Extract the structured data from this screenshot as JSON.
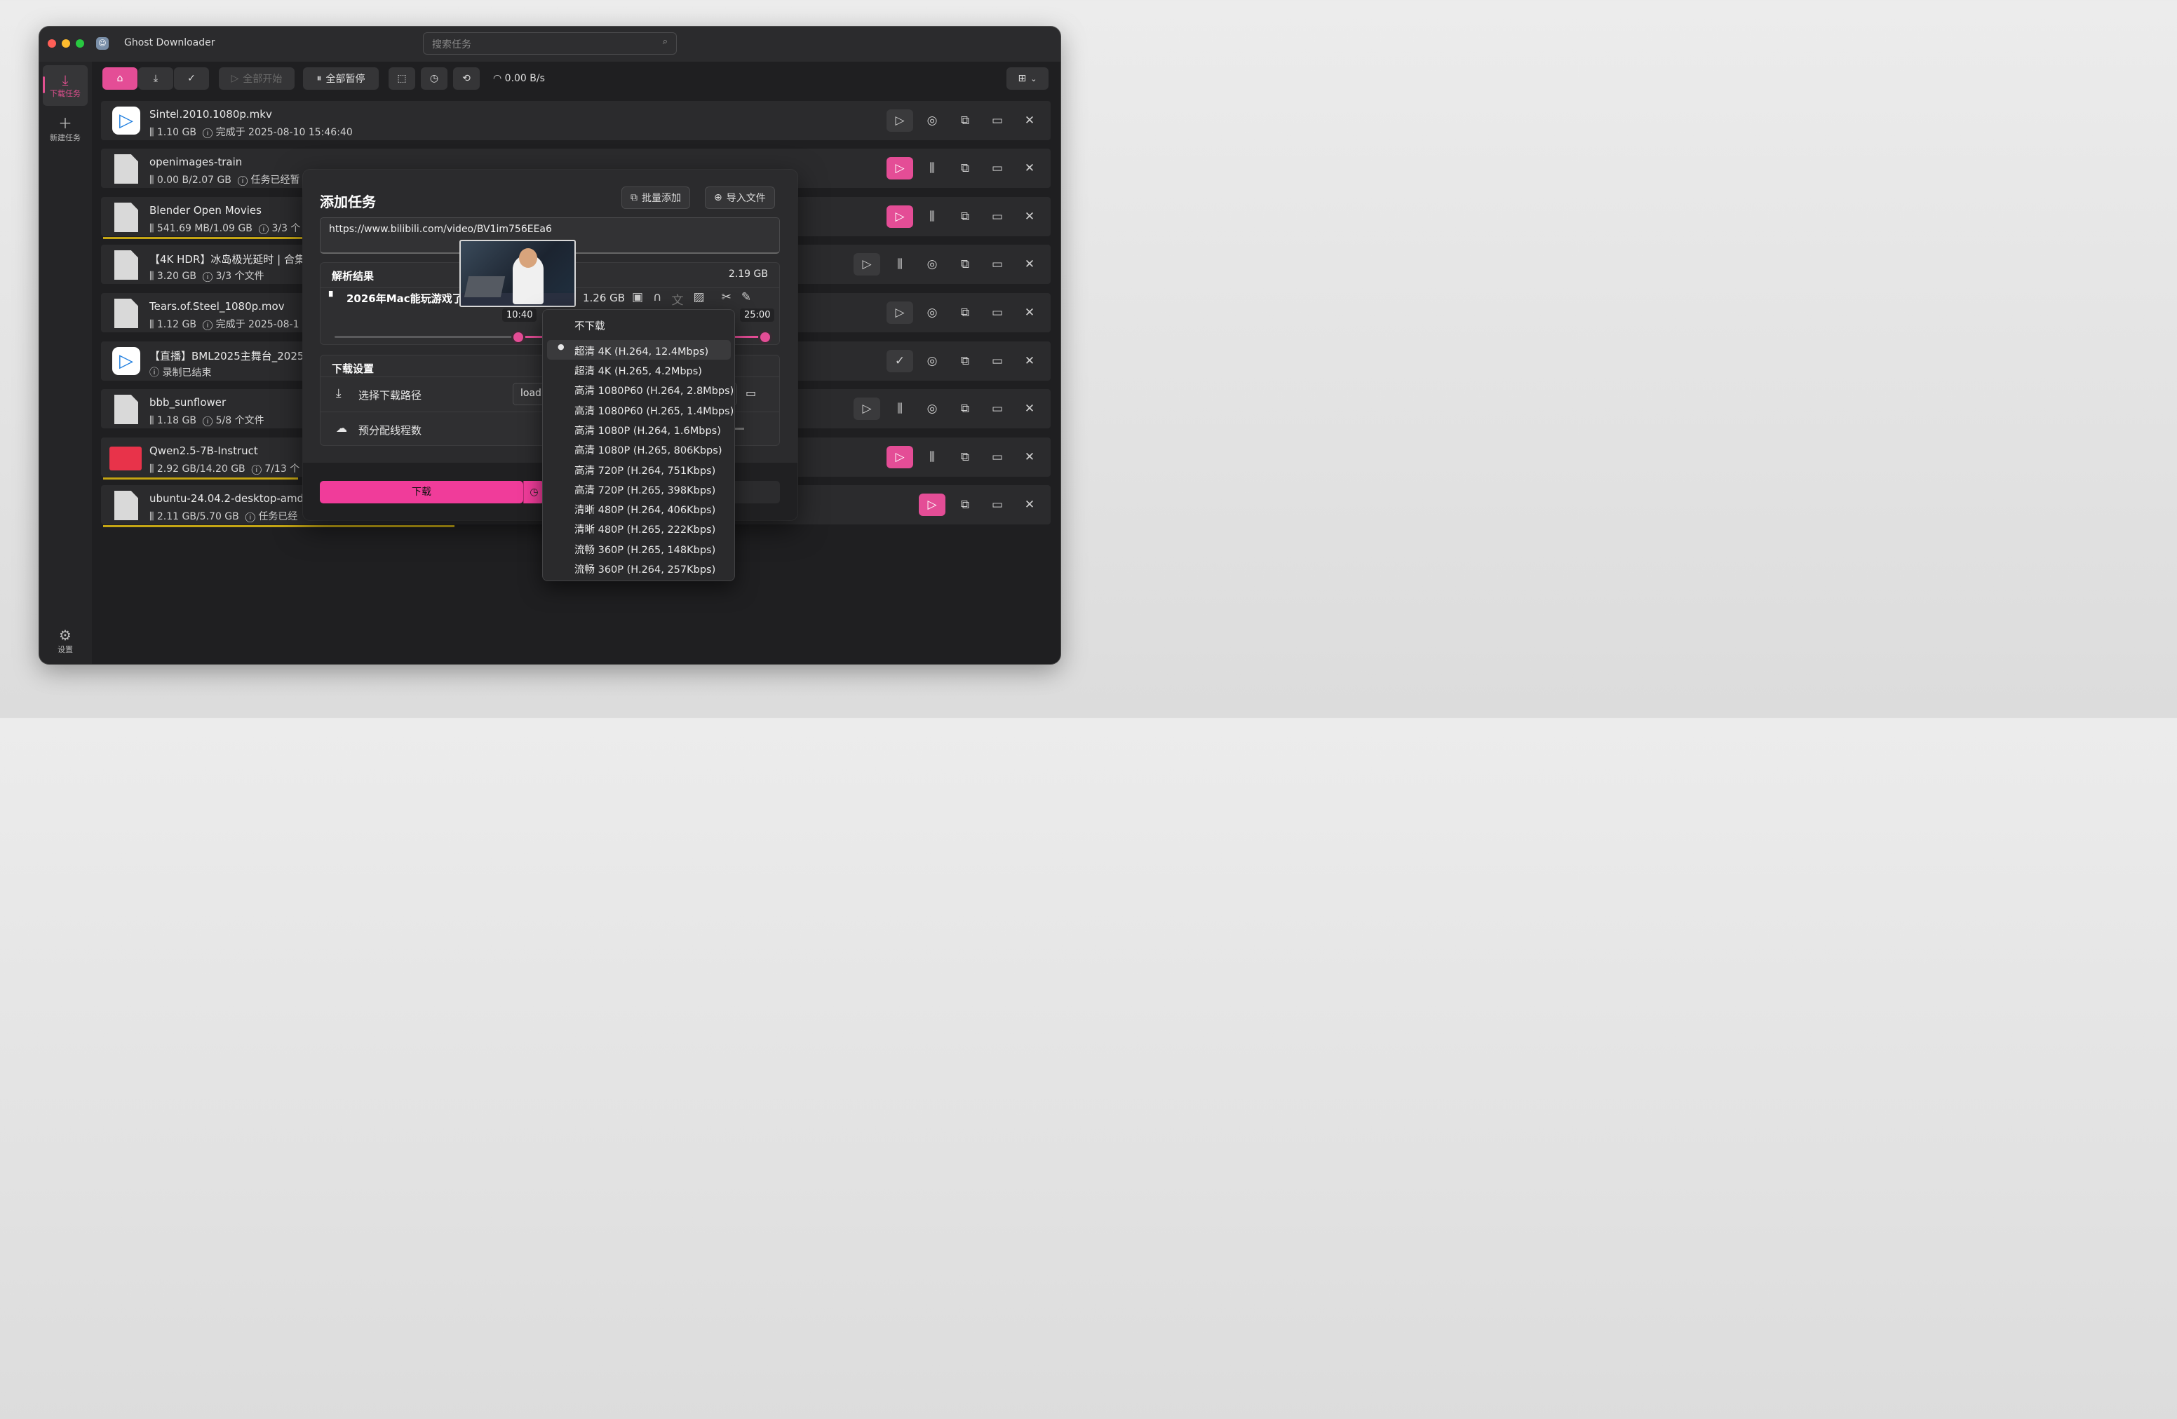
{
  "app": {
    "title": "Ghost Downloader",
    "icon": "ghost-icon"
  },
  "search": {
    "placeholder": "搜索任务"
  },
  "sidebar": {
    "items": [
      {
        "label": "下载任务",
        "icon": "download-icon"
      },
      {
        "label": "新建任务",
        "icon": "plus-icon"
      }
    ],
    "settings": "设置"
  },
  "toolbar": {
    "start_all": "全部开始",
    "pause_all": "全部暂停",
    "speed": "0.00 B/s"
  },
  "tasks": [
    {
      "name": "Sintel.2010.1080p.mkv",
      "size": "1.10 GB",
      "status": "完成于 2025-08-10 15:46:40"
    },
    {
      "name": "openimages-train",
      "size": "0.00 B/2.07 GB",
      "status": "任务已经暂"
    },
    {
      "name": "Blender Open Movies",
      "size": "541.69 MB/1.09 GB",
      "status": "3/3 个",
      "progress": 0.5
    },
    {
      "name": "【4K HDR】冰岛极光延时 | 合集",
      "size": "3.20 GB",
      "status": "3/3 个文件"
    },
    {
      "name": "Tears.of.Steel_1080p.mov",
      "size": "1.12 GB",
      "status": "完成于 2025-08-1"
    },
    {
      "name": "【直播】BML2025主舞台_20250",
      "size": "",
      "status": "录制已结束"
    },
    {
      "name": "bbb_sunflower",
      "size": "1.18 GB",
      "status": "5/8 个文件"
    },
    {
      "name": "Qwen2.5-7B-Instruct",
      "size": "2.92 GB/14.20 GB",
      "status": "7/13 个",
      "progress": 0.2
    },
    {
      "name": "ubuntu-24.04.2-desktop-amd6",
      "size": "2.11 GB/5.70 GB",
      "status": "任务已经",
      "progress": 0.37
    }
  ],
  "dialog": {
    "title": "添加任务",
    "batch_add": "批量添加",
    "import_file": "导入文件",
    "url": "https://www.bilibili.com/video/BV1im756EEa6",
    "parse_header": "解析结果",
    "total_size": "2.19 GB",
    "file_name": "2026年Mac能玩游戏了吗",
    "file_size": "1.26 GB",
    "time_start": "10:40",
    "time_end": "25:00",
    "settings_header": "下载设置",
    "path_label": "选择下载路径",
    "path_value": "load",
    "threads_label": "预分配线程数",
    "download_button": "下载"
  },
  "quality_menu": {
    "items": [
      "不下载",
      "超清 4K (H.264, 12.4Mbps)",
      "超清 4K (H.265, 4.2Mbps)",
      "高清 1080P60 (H.264, 2.8Mbps)",
      "高清 1080P60 (H.265, 1.4Mbps)",
      "高清 1080P (H.264, 1.6Mbps)",
      "高清 1080P (H.265, 806Kbps)",
      "高清 720P (H.264, 751Kbps)",
      "高清 720P (H.265, 398Kbps)",
      "清晰 480P (H.264, 406Kbps)",
      "清晰 480P (H.265, 222Kbps)",
      "流畅 360P (H.265, 148Kbps)",
      "流畅 360P (H.264, 257Kbps)"
    ],
    "selected": "超清 4K (H.264, 12.4Mbps)"
  },
  "colors": {
    "accent": "#e44d96",
    "progress": "#c4a514",
    "background": "#1f1f21"
  }
}
